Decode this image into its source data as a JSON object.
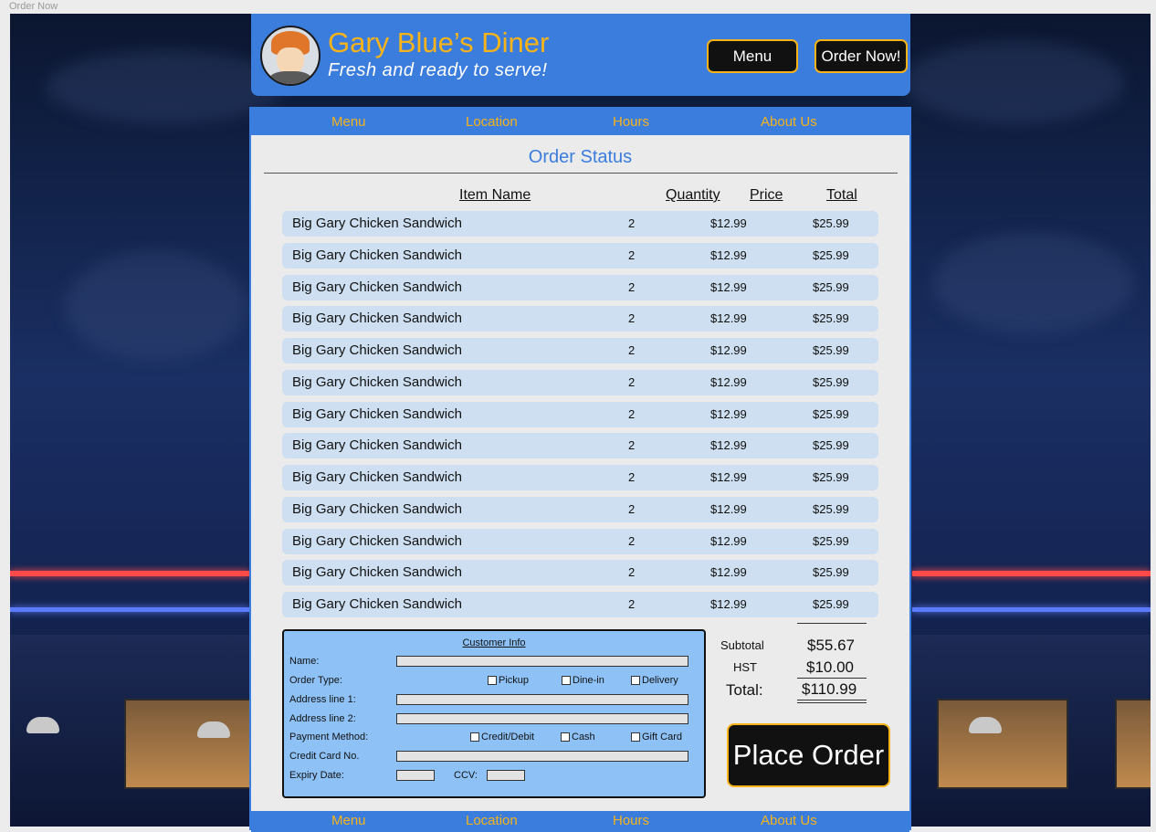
{
  "artboard": {
    "title": "Order Now"
  },
  "header": {
    "brand": "Gary Blue’s Diner",
    "tagline": "Fresh and ready to serve!",
    "menu_button": "Menu",
    "order_button": "Order Now!"
  },
  "nav": {
    "items": [
      "Menu",
      "Location",
      "Hours",
      "About Us"
    ]
  },
  "order": {
    "title": "Order Status",
    "columns": {
      "name": "Item Name",
      "quantity": "Quantity",
      "price": "Price",
      "total": "Total"
    },
    "items": [
      {
        "name": "Big Gary Chicken Sandwich",
        "quantity": "2",
        "price": "$12.99",
        "total": "$25.99"
      },
      {
        "name": "Big Gary Chicken Sandwich",
        "quantity": "2",
        "price": "$12.99",
        "total": "$25.99"
      },
      {
        "name": "Big Gary Chicken Sandwich",
        "quantity": "2",
        "price": "$12.99",
        "total": "$25.99"
      },
      {
        "name": "Big Gary Chicken Sandwich",
        "quantity": "2",
        "price": "$12.99",
        "total": "$25.99"
      },
      {
        "name": "Big Gary Chicken Sandwich",
        "quantity": "2",
        "price": "$12.99",
        "total": "$25.99"
      },
      {
        "name": "Big Gary Chicken Sandwich",
        "quantity": "2",
        "price": "$12.99",
        "total": "$25.99"
      },
      {
        "name": "Big Gary Chicken Sandwich",
        "quantity": "2",
        "price": "$12.99",
        "total": "$25.99"
      },
      {
        "name": "Big Gary Chicken Sandwich",
        "quantity": "2",
        "price": "$12.99",
        "total": "$25.99"
      },
      {
        "name": "Big Gary Chicken Sandwich",
        "quantity": "2",
        "price": "$12.99",
        "total": "$25.99"
      },
      {
        "name": "Big Gary Chicken Sandwich",
        "quantity": "2",
        "price": "$12.99",
        "total": "$25.99"
      },
      {
        "name": "Big Gary Chicken Sandwich",
        "quantity": "2",
        "price": "$12.99",
        "total": "$25.99"
      },
      {
        "name": "Big Gary Chicken Sandwich",
        "quantity": "2",
        "price": "$12.99",
        "total": "$25.99"
      },
      {
        "name": "Big Gary Chicken Sandwich",
        "quantity": "2",
        "price": "$12.99",
        "total": "$25.99"
      }
    ]
  },
  "customer": {
    "title": "Customer Info",
    "name_label": "Name:",
    "order_type_label": "Order Type:",
    "order_types": [
      "Pickup",
      "Dine-in",
      "Delivery"
    ],
    "address1_label": "Address line 1:",
    "address2_label": "Address line 2:",
    "payment_label": "Payment Method:",
    "payment_methods": [
      "Credit/Debit",
      "Cash",
      "Gift Card"
    ],
    "card_label": "Credit Card No.",
    "expiry_label": "Expiry Date:",
    "ccv_label": "CCV:"
  },
  "summary": {
    "subtotal_label": "Subtotal",
    "subtotal": "$55.67",
    "hst_label": "HST",
    "hst": "$10.00",
    "total_label": "Total:",
    "total": "$110.99"
  },
  "place_order": "Place Order",
  "footer": {
    "items": [
      "Menu",
      "Location",
      "Hours",
      "About Us"
    ]
  }
}
